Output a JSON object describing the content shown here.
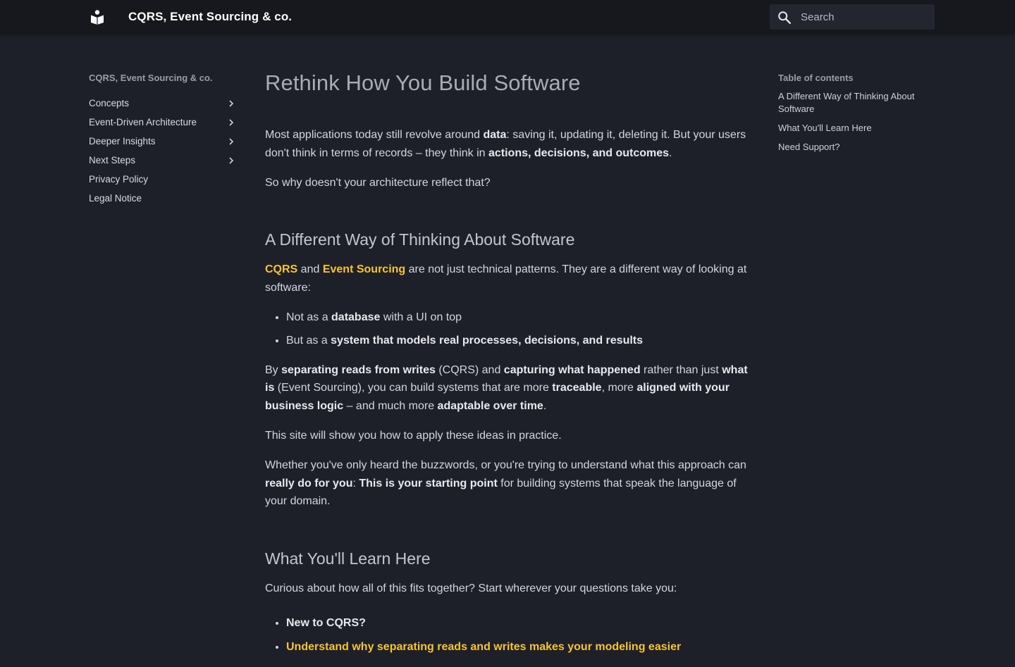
{
  "header": {
    "site_title": "CQRS, Event Sourcing & co.",
    "search_placeholder": "Search",
    "logo_icon": "book-reader-icon",
    "search_icon": "magnifier-icon"
  },
  "sidebar": {
    "title": "CQRS, Event Sourcing & co.",
    "items": [
      {
        "label": "Concepts",
        "expandable": true
      },
      {
        "label": "Event-Driven Architecture",
        "expandable": true
      },
      {
        "label": "Deeper Insights",
        "expandable": true
      },
      {
        "label": "Next Steps",
        "expandable": true
      },
      {
        "label": "Privacy Policy",
        "expandable": false
      },
      {
        "label": "Legal Notice",
        "expandable": false
      }
    ]
  },
  "main": {
    "title": "Rethink How You Build Software",
    "intro": {
      "p1a": "Most applications today still revolve around ",
      "p1b": "data",
      "p1c": ": saving it, updating it, deleting it. But your users don't think in terms of records – they think in ",
      "p1d": "actions, decisions, and outcomes",
      "p1e": ".",
      "p2": "So why doesn't your architecture reflect that?"
    },
    "section1": {
      "heading": "A Different Way of Thinking About Software",
      "p1_link1": "CQRS",
      "p1_and": " and ",
      "p1_link2": "Event Sourcing",
      "p1_rest": " are not just technical patterns. They are a different way of looking at software:",
      "bullet1a": "Not as a ",
      "bullet1b": "database",
      "bullet1c": " with a UI on top",
      "bullet2a": "But as a ",
      "bullet2b": "system that models real processes, decisions, and results",
      "p2a": "By ",
      "p2b": "separating reads from writes",
      "p2c": " (CQRS) and ",
      "p2d": "capturing what happened",
      "p2e": " rather than just ",
      "p2f": "what is",
      "p2g": " (Event Sourcing), you can build systems that are more ",
      "p2h": "traceable",
      "p2i": ", more ",
      "p2j": "aligned with your business logic",
      "p2k": " – and much more ",
      "p2l": "adaptable over time",
      "p2m": ".",
      "p3": "This site will show you how to apply these ideas in practice.",
      "p4a": "Whether you've only heard the buzzwords, or you're trying to understand what this approach can ",
      "p4b": "really do for you",
      "p4c": ": ",
      "p4d": "This is your starting point",
      "p4e": " for building systems that speak the language of your domain."
    },
    "section2": {
      "heading": "What You'll Learn Here",
      "p1": "Curious about how all of this fits together? Start wherever your questions take you:",
      "bullet1": "New to CQRS?",
      "bullet1_link": "Understand why separating reads and writes makes your modeling easier"
    }
  },
  "toc": {
    "title": "Table of contents",
    "items": [
      "A Different Way of Thinking About Software",
      "What You'll Learn Here",
      "Need Support?"
    ]
  },
  "colors": {
    "background": "#1e2029",
    "header": "#17181e",
    "accent": "#f7c531"
  }
}
